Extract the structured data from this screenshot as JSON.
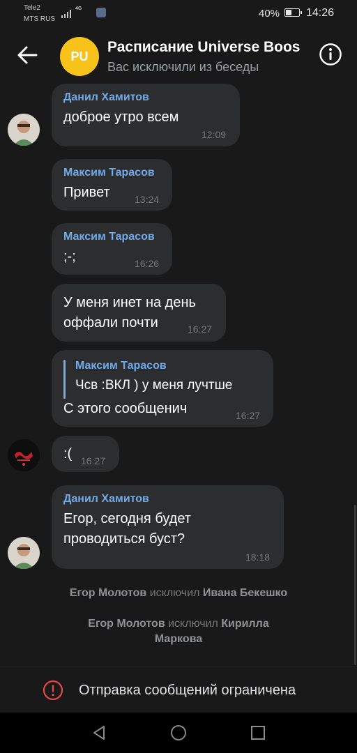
{
  "status_bar": {
    "carrier1": "Tele2",
    "carrier2": "MTS RUS",
    "network": "4G",
    "battery": "40%",
    "battery_level": 0.4,
    "time": "14:26"
  },
  "header": {
    "avatar_initials": "PU",
    "avatar_color": "#f7c21a",
    "title": "Расписание Universe Boos",
    "subtitle": "Вас исключили из беседы"
  },
  "messages": [
    {
      "sender": "Данил Хамитов",
      "lines": [
        "доброе утро всем"
      ],
      "time": "12:09"
    },
    {
      "sender": "Максим Тарасов",
      "lines": [
        "Привет"
      ],
      "time": "13:24"
    },
    {
      "sender": "Максим Тарасов",
      "lines": [
        ";-;"
      ],
      "time": "16:26"
    },
    {
      "sender": "",
      "lines": [
        "У меня инет на день",
        "оффали почти"
      ],
      "time": "16:27"
    },
    {
      "reply_sender": "Максим Тарасов",
      "reply_text": "Чсв :ВКЛ ) у меня лучтше",
      "lines": [
        "С этого  сообщенич"
      ],
      "time": "16:27"
    },
    {
      "sender": "",
      "lines": [
        ":("
      ],
      "time": "16:27"
    },
    {
      "sender": "Данил Хамитов",
      "lines": [
        "Егор, сегодня будет",
        "проводиться буст?"
      ],
      "time": "18:18"
    }
  ],
  "system_messages": [
    {
      "actor": "Егор Молотов",
      "action": "исключил",
      "target": "Ивана Бекешко"
    },
    {
      "actor": "Егор Молотов",
      "action": "исключил",
      "target": "Кирилла Маркова"
    }
  ],
  "footer": {
    "restricted_text": "Отправка сообщений ограничена"
  },
  "colors": {
    "background": "#19191a",
    "bubble": "#2c2d2e",
    "sender_name": "#71aaeb",
    "warning": "#e64646"
  }
}
